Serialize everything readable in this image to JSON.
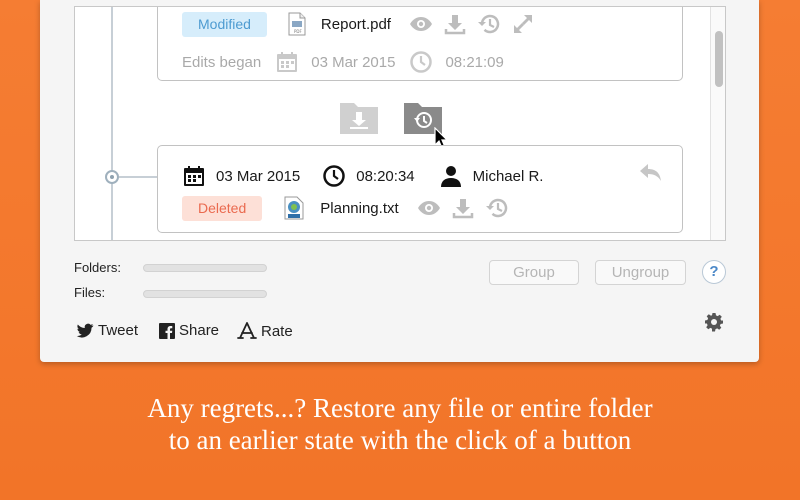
{
  "cards": {
    "top": {
      "status": "Modified",
      "file_name": "Report.pdf",
      "edits_label": "Edits began",
      "date": "03 Mar 2015",
      "time": "08:21:09"
    },
    "bottom": {
      "date": "03 Mar 2015",
      "time": "08:20:34",
      "user": "Michael R.",
      "status": "Deleted",
      "file_name": "Planning.txt"
    }
  },
  "stats": {
    "folders_label": "Folders:",
    "files_label": "Files:"
  },
  "buttons": {
    "group": "Group",
    "ungroup": "Ungroup",
    "help": "?"
  },
  "social": {
    "tweet": "Tweet",
    "share": "Share",
    "rate": "Rate"
  },
  "caption": {
    "line1": "Any regrets...? Restore any file or entire folder",
    "line2": "to an earlier state with the click of a button"
  },
  "colors": {
    "background": "#f57d33",
    "modified_badge": "#d6edfb",
    "deleted_badge": "#fde0d7"
  },
  "icons": [
    "calendar-icon",
    "clock-icon",
    "user-icon",
    "eye-icon",
    "download-icon",
    "history-icon",
    "expand-icon",
    "undo-icon",
    "folder-download-icon",
    "folder-restore-icon",
    "twitter-icon",
    "facebook-icon",
    "appstore-icon",
    "gear-icon"
  ]
}
